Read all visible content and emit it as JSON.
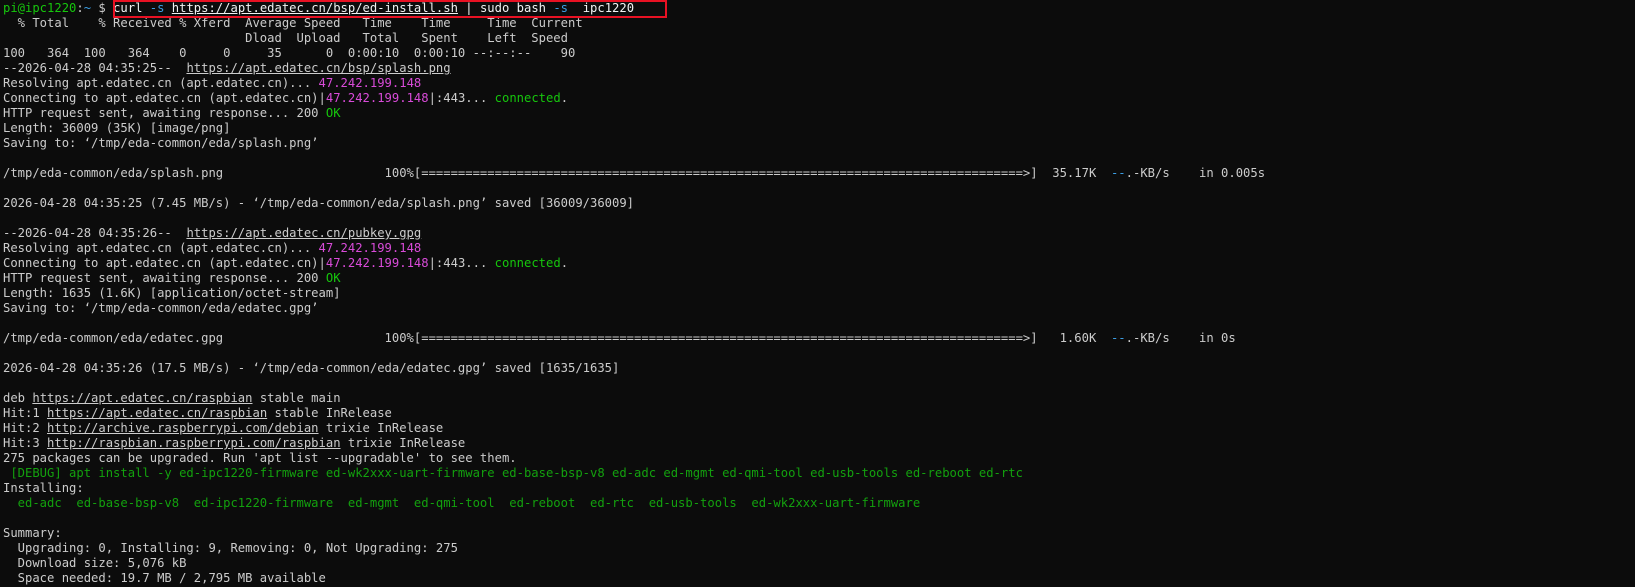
{
  "highlight": {
    "color": "#e81123",
    "target": "command"
  },
  "colors": {
    "background": "#0c0c0c",
    "text": "#cccccc",
    "prompt": "#16c60c",
    "ip": "#d94bd9",
    "ok": "#16c60c",
    "debug": "#13a10e",
    "dir": "#3b9ee4"
  },
  "lines": [
    [
      {
        "t": "pi@ipc1220",
        "c": "green"
      },
      {
        "t": ":",
        "c": ""
      },
      {
        "t": "~",
        "c": "cyan"
      },
      {
        "t": " $ ",
        "c": ""
      },
      {
        "t": "curl ",
        "c": "white"
      },
      {
        "t": "-s ",
        "c": "cyan"
      },
      {
        "t": "https://apt.edatec.cn/bsp/ed-install.sh",
        "c": "white",
        "u": true
      },
      {
        "t": " | sudo bash ",
        "c": "white"
      },
      {
        "t": "-s ",
        "c": "cyan"
      },
      {
        "t": " ipc1220",
        "c": "white"
      }
    ],
    [
      {
        "t": "  % Total    % Received % Xferd  Average Speed   Time    Time     Time  Current",
        "c": ""
      }
    ],
    [
      {
        "t": "                                 Dload  Upload   Total   Spent    Left  Speed",
        "c": ""
      }
    ],
    [
      {
        "t": "100   364  100   364    0     0     35      0  0:00:10  0:00:10 --:--:--    90",
        "c": ""
      }
    ],
    [
      {
        "t": "--2026-04-28 04:35:25--  ",
        "c": ""
      },
      {
        "t": "https://apt.edatec.cn/bsp/splash.png",
        "c": "",
        "u": true
      }
    ],
    [
      {
        "t": "Resolving apt.edatec.cn (apt.edatec.cn)... ",
        "c": ""
      },
      {
        "t": "47.242.199.148",
        "c": "magenta"
      }
    ],
    [
      {
        "t": "Connecting to apt.edatec.cn (apt.edatec.cn)|",
        "c": ""
      },
      {
        "t": "47.242.199.148",
        "c": "magenta"
      },
      {
        "t": "|:443... ",
        "c": ""
      },
      {
        "t": "connected",
        "c": "ok"
      },
      {
        "t": ".",
        "c": ""
      }
    ],
    [
      {
        "t": "HTTP request sent, awaiting response... 200 ",
        "c": ""
      },
      {
        "t": "OK",
        "c": "ok"
      }
    ],
    [
      {
        "t": "Length: 36009 (35K) [image/png]",
        "c": ""
      }
    ],
    [
      {
        "t": "Saving to: ‘/tmp/eda-common/eda/splash.png’",
        "c": ""
      }
    ],
    [
      {
        "t": "",
        "c": ""
      }
    ],
    [
      {
        "t": "/tmp/eda-common/eda/splash.png                      100%[==================================================================================>]  35.17K  ",
        "c": ""
      },
      {
        "t": "--",
        "c": "cyan"
      },
      {
        "t": ".-KB/s    in 0.005s",
        "c": ""
      }
    ],
    [
      {
        "t": "",
        "c": ""
      }
    ],
    [
      {
        "t": "2026-04-28 04:35:25 (7.45 MB/s) - ‘/tmp/eda-common/eda/splash.png’ saved [36009/36009]",
        "c": ""
      }
    ],
    [
      {
        "t": "",
        "c": ""
      }
    ],
    [
      {
        "t": "--2026-04-28 04:35:26--  ",
        "c": ""
      },
      {
        "t": "https://apt.edatec.cn/pubkey.gpg",
        "c": "",
        "u": true
      }
    ],
    [
      {
        "t": "Resolving apt.edatec.cn (apt.edatec.cn)... ",
        "c": ""
      },
      {
        "t": "47.242.199.148",
        "c": "magenta"
      }
    ],
    [
      {
        "t": "Connecting to apt.edatec.cn (apt.edatec.cn)|",
        "c": ""
      },
      {
        "t": "47.242.199.148",
        "c": "magenta"
      },
      {
        "t": "|:443... ",
        "c": ""
      },
      {
        "t": "connected",
        "c": "ok"
      },
      {
        "t": ".",
        "c": ""
      }
    ],
    [
      {
        "t": "HTTP request sent, awaiting response... 200 ",
        "c": ""
      },
      {
        "t": "OK",
        "c": "ok"
      }
    ],
    [
      {
        "t": "Length: 1635 (1.6K) [application/octet-stream]",
        "c": ""
      }
    ],
    [
      {
        "t": "Saving to: ‘/tmp/eda-common/eda/edatec.gpg’",
        "c": ""
      }
    ],
    [
      {
        "t": "",
        "c": ""
      }
    ],
    [
      {
        "t": "/tmp/eda-common/eda/edatec.gpg                      100%[==================================================================================>]   1.60K  ",
        "c": ""
      },
      {
        "t": "--",
        "c": "cyan"
      },
      {
        "t": ".-KB/s    in 0s",
        "c": ""
      }
    ],
    [
      {
        "t": "",
        "c": ""
      }
    ],
    [
      {
        "t": "2026-04-28 04:35:26 (17.5 MB/s) - ‘/tmp/eda-common/eda/edatec.gpg’ saved [1635/1635]",
        "c": ""
      }
    ],
    [
      {
        "t": "",
        "c": ""
      }
    ],
    [
      {
        "t": "deb ",
        "c": ""
      },
      {
        "t": "https://apt.edatec.cn/raspbian",
        "c": "",
        "u": true
      },
      {
        "t": " stable main",
        "c": ""
      }
    ],
    [
      {
        "t": "Hit:1 ",
        "c": ""
      },
      {
        "t": "https://apt.edatec.cn/raspbian",
        "c": "",
        "u": true
      },
      {
        "t": " stable InRelease",
        "c": ""
      }
    ],
    [
      {
        "t": "Hit:2 ",
        "c": ""
      },
      {
        "t": "http://archive.raspberrypi.com/debian",
        "c": "",
        "u": true
      },
      {
        "t": " trixie InRelease",
        "c": ""
      }
    ],
    [
      {
        "t": "Hit:3 ",
        "c": ""
      },
      {
        "t": "http://raspbian.raspberrypi.com/raspbian",
        "c": "",
        "u": true
      },
      {
        "t": " trixie InRelease",
        "c": ""
      }
    ],
    [
      {
        "t": "275 packages can be upgraded. Run 'apt list --upgradable' to see them.",
        "c": ""
      }
    ],
    [
      {
        "t": " [DEBUG] apt install -y ed-ipc1220-firmware ed-wk2xxx-uart-firmware ed-base-bsp-v8 ed-adc ed-mgmt ed-qmi-tool ed-usb-tools ed-reboot ed-rtc",
        "c": "teal"
      }
    ],
    [
      {
        "t": "Installing:",
        "c": ""
      }
    ],
    [
      {
        "t": "  ed-adc  ed-base-bsp-v8  ed-ipc1220-firmware  ed-mgmt  ed-qmi-tool  ed-reboot  ed-rtc  ed-usb-tools  ed-wk2xxx-uart-firmware",
        "c": "teal"
      }
    ],
    [
      {
        "t": "",
        "c": ""
      }
    ],
    [
      {
        "t": "Summary:",
        "c": ""
      }
    ],
    [
      {
        "t": "  Upgrading: 0, Installing: 9, Removing: 0, Not Upgrading: 275",
        "c": ""
      }
    ],
    [
      {
        "t": "  Download size: 5,076 kB",
        "c": ""
      }
    ],
    [
      {
        "t": "  Space needed: 19.7 MB / 2,795 MB available",
        "c": ""
      }
    ]
  ]
}
